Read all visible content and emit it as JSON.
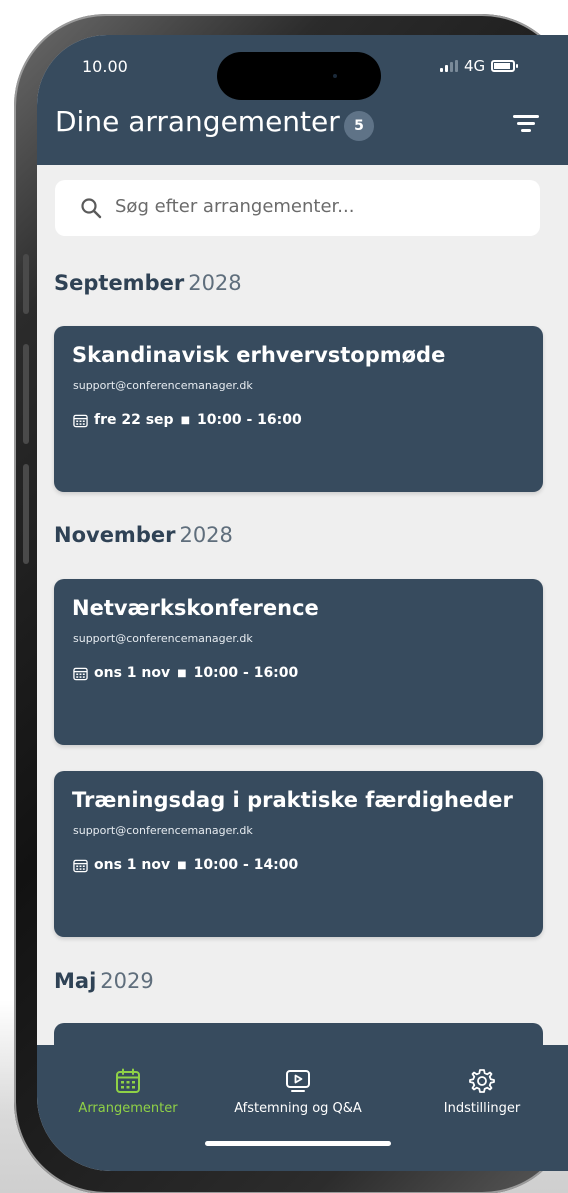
{
  "status_bar": {
    "time": "10.00",
    "network": "4G"
  },
  "header": {
    "title": "Dine arrangementer",
    "badge_count": "5"
  },
  "search": {
    "placeholder": "Søg efter arrangementer..."
  },
  "sections": [
    {
      "month": "September",
      "year": "2028",
      "events": [
        {
          "title": "Skandinavisk erhvervstopmøde",
          "email": "support@conferencemanager.dk",
          "date": "fre 22 sep",
          "time": "10:00 - 16:00"
        }
      ]
    },
    {
      "month": "November",
      "year": "2028",
      "events": [
        {
          "title": "Netværkskonference",
          "email": "support@conferencemanager.dk",
          "date": "ons 1 nov",
          "time": "10:00 - 16:00"
        },
        {
          "title": "Træningsdag i praktiske færdigheder",
          "email": "support@conferencemanager.dk",
          "date": "ons 1 nov",
          "time": "10:00 - 14:00"
        }
      ]
    },
    {
      "month": "Maj",
      "year": "2029",
      "events": []
    }
  ],
  "bottom_nav": {
    "items": [
      {
        "label": "Arrangementer",
        "icon": "calendar-icon",
        "active": true
      },
      {
        "label": "Afstemning og Q&A",
        "icon": "play-screen-icon",
        "active": false
      },
      {
        "label": "Indstillinger",
        "icon": "gear-icon",
        "active": false
      }
    ]
  },
  "colors": {
    "primary": "#374b5e",
    "background": "#efefef",
    "accent_active": "#8fd146",
    "badge": "#5f7387"
  }
}
